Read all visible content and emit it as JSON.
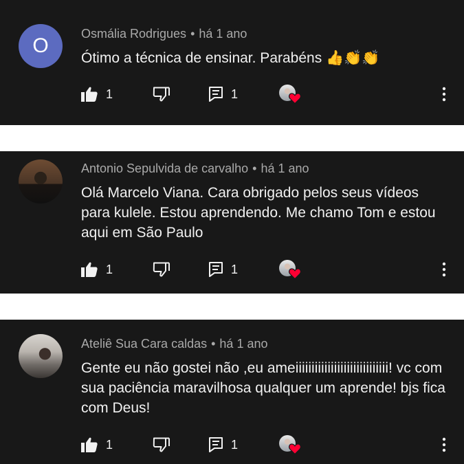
{
  "comments": [
    {
      "avatar_letter": "O",
      "author": "Osmália Rodrigues",
      "separator": "•",
      "time": "há 1 ano",
      "text": "Ótimo a técnica de ensinar.  Parabéns 👍👏👏",
      "likes": "1",
      "replies": "1"
    },
    {
      "avatar_letter": "",
      "author": "Antonio Sepulvida de carvalho",
      "separator": "•",
      "time": "há 1 ano",
      "text": "Olá Marcelo Viana. Cara obrigado pelos seus vídeos para kulele. Estou aprendendo. Me chamo Tom e estou aqui em São Paulo",
      "likes": "1",
      "replies": "1"
    },
    {
      "avatar_letter": "",
      "author": "Ateliê Sua Cara caldas",
      "separator": "•",
      "time": "há 1 ano",
      "text": "Gente eu não gostei não ,eu ameiiiiiiiiiiiiiiiiiiiiiiiiiiiii! vc com sua paciência maravilhosa qualquer um aprende! bjs fica com Deus!",
      "likes": "1",
      "replies": "1"
    }
  ],
  "icons": {
    "like": "thumbs-up-icon",
    "dislike": "thumbs-down-icon",
    "reply": "comment-icon",
    "creator_heart": "heart-icon",
    "more": "more-vert-icon"
  },
  "colors": {
    "card_background": "#181818",
    "page_background": "#ffffff",
    "avatar_letter_bg": "#5c6bc0",
    "heart": "#ff0033"
  }
}
